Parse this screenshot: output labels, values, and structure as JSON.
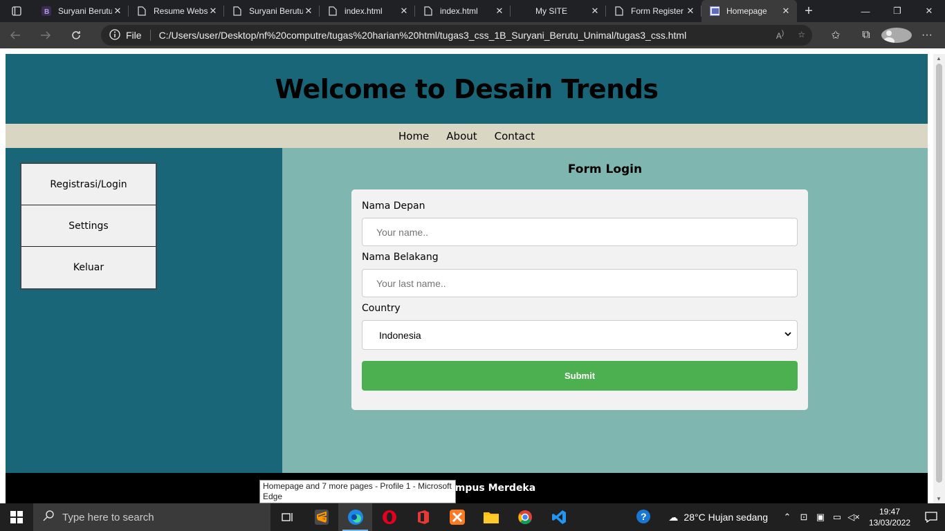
{
  "browser": {
    "tabs": [
      {
        "title": "Suryani Berutu",
        "icon": "bootstrap-icon"
      },
      {
        "title": "Resume Website",
        "icon": "page-icon"
      },
      {
        "title": "Suryani Berutu",
        "icon": "page-icon"
      },
      {
        "title": "index.html",
        "icon": "page-icon"
      },
      {
        "title": "index.html",
        "icon": "page-icon"
      },
      {
        "title": "My SITE",
        "icon": "none"
      },
      {
        "title": "Form Register",
        "icon": "page-icon"
      },
      {
        "title": "Homepage",
        "icon": "image-icon",
        "active": true
      }
    ],
    "file_label": "File",
    "url": "C:/Users/user/Desktop/nf%20computre/tugas%20harian%20html/tugas3_css_1B_Suryani_Berutu_Unimal/tugas3_css.html",
    "tooltip": "Homepage and 7 more pages - Profile 1 - Microsoft Edge"
  },
  "page": {
    "header_title": "Welcome to Desain Trends",
    "nav": [
      "Home",
      "About",
      "Contact"
    ],
    "sidebar": [
      "Registrasi/Login",
      "Settings",
      "Keluar"
    ],
    "form": {
      "title": "Form Login",
      "first_name_label": "Nama Depan",
      "first_name_placeholder": "Your name..",
      "last_name_label": "Nama Belakang",
      "last_name_placeholder": "Your last name..",
      "country_label": "Country",
      "country_value": "Indonesia",
      "submit_label": "Submit"
    },
    "footer": "© 2022 Kampus Merdeka"
  },
  "taskbar": {
    "search_placeholder": "Type here to search",
    "weather": "28°C  Hujan sedang",
    "time": "19:47",
    "date": "13/03/2022"
  },
  "colors": {
    "header_bg": "#1a6679",
    "nav_bg": "#d9d6c4",
    "main_bg": "#7fb7b0",
    "submit_bg": "#4caf50"
  }
}
